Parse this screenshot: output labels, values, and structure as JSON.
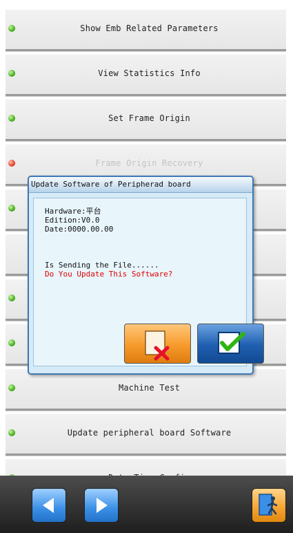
{
  "menu": {
    "items": [
      {
        "label": "Show Emb Related Parameters",
        "status": "green"
      },
      {
        "label": "View Statistics Info",
        "status": "green"
      },
      {
        "label": "Set Frame Origin",
        "status": "green"
      },
      {
        "label": "Frame Origin Recovery",
        "status": "red"
      },
      {
        "label": "",
        "status": "green"
      },
      {
        "label": "",
        "status": "none"
      },
      {
        "label": "",
        "status": "green"
      },
      {
        "label": "",
        "status": "green"
      },
      {
        "label": "Machine Test",
        "status": "green"
      },
      {
        "label": "Update peripheral board Software",
        "status": "green"
      },
      {
        "label": "Date Time Config",
        "status": "green"
      }
    ]
  },
  "dialog": {
    "title": "Update Software of Peripherad board",
    "hardware": "Hardware:平台",
    "edition": "Edition:V0.0",
    "date": "Date:0000.00.00",
    "sending": "Is Sending the File......",
    "question": "Do You Update This Software?"
  },
  "icons": {
    "status_ok": "green-status-icon",
    "status_error": "red-status-icon",
    "cancel": "cancel-doc-icon",
    "confirm": "checkmark-icon",
    "prev": "arrow-left-icon",
    "next": "arrow-right-icon",
    "exit": "exit-door-icon"
  },
  "colors": {
    "accent_blue": "#2a6fc4",
    "accent_orange": "#f5a22f",
    "warning_red": "#e00000",
    "ok_green": "#46b11b"
  }
}
